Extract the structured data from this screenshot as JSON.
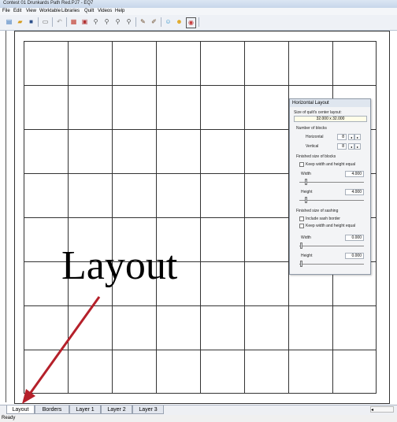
{
  "window": {
    "title": "Contest 01 Drunkards Path Red.PJ7 - EQ7"
  },
  "menu": [
    "File",
    "Edit",
    "View",
    "Worktable",
    "Libraries",
    "Quilt",
    "Videos",
    "Help"
  ],
  "toolbar_icons": [
    "new-icon",
    "open-icon",
    "save-icon",
    "print-icon",
    "undo-icon",
    "quilt-icon",
    "image-icon",
    "zoom-in-icon",
    "zoom-out-icon",
    "zoom-fit-icon",
    "zoom-icon",
    "edit-icon",
    "color-icon",
    "face-icon",
    "sun-icon",
    "rainbow-icon"
  ],
  "annotation": {
    "text": "Layout"
  },
  "panel": {
    "title": "Horizontal Layout",
    "size_label": "Size of quilt's center layout:",
    "size_value": "32.000 x 32.000",
    "num_blocks": "Number of blocks",
    "horizontal_label": "Horizontal",
    "horizontal_value": "8",
    "vertical_label": "Vertical",
    "vertical_value": "8",
    "finished_blocks": "Finished size of blocks",
    "keep_equal_blocks": "Keep width and height equal",
    "width_label": "Width",
    "width_value": "4.000",
    "height_label": "Height",
    "height_value": "4.000",
    "finished_sashing": "Finished size of sashing",
    "include_sash_border": "Include sash border",
    "keep_equal_sash": "Keep width and height equal",
    "sash_width_label": "Width",
    "sash_width_value": "0.000",
    "sash_height_label": "Height",
    "sash_height_value": "0.000"
  },
  "tabs": [
    {
      "label": "Layout",
      "active": true
    },
    {
      "label": "Borders",
      "active": false
    },
    {
      "label": "Layer 1",
      "active": false
    },
    {
      "label": "Layer 2",
      "active": false
    },
    {
      "label": "Layer 3",
      "active": false
    }
  ],
  "status": {
    "text": "Ready"
  },
  "colors": {
    "arrow": "#b5202a"
  }
}
